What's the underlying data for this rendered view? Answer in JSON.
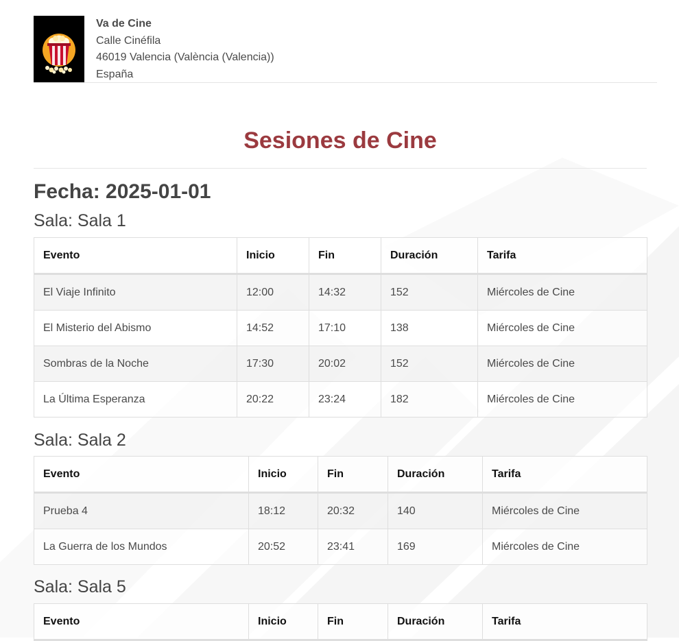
{
  "company": {
    "name": "Va de Cine",
    "street": "Calle Cinéfila",
    "city": "46019 Valencia (València (Valencia))",
    "country": "España"
  },
  "report": {
    "title": "Sesiones de Cine",
    "date_label": "Fecha: 2025-01-01"
  },
  "columns": [
    "Evento",
    "Inicio",
    "Fin",
    "Duración",
    "Tarifa"
  ],
  "rooms": [
    {
      "label": "Sala: Sala 1",
      "rows": [
        [
          "El Viaje Infinito",
          "12:00",
          "14:32",
          "152",
          "Miércoles de Cine"
        ],
        [
          "El Misterio del Abismo",
          "14:52",
          "17:10",
          "138",
          "Miércoles de Cine"
        ],
        [
          "Sombras de la Noche",
          "17:30",
          "20:02",
          "152",
          "Miércoles de Cine"
        ],
        [
          "La Última Esperanza",
          "20:22",
          "23:24",
          "182",
          "Miércoles de Cine"
        ]
      ]
    },
    {
      "label": "Sala: Sala 2",
      "rows": [
        [
          "Prueba 4",
          "18:12",
          "20:32",
          "140",
          "Miércoles de Cine"
        ],
        [
          "La Guerra de los Mundos",
          "20:52",
          "23:41",
          "169",
          "Miércoles de Cine"
        ]
      ]
    },
    {
      "label": "Sala: Sala 5",
      "rows": []
    }
  ],
  "colors": {
    "title": "#9b3a3f",
    "logo_bg": "#000000",
    "popcorn_red": "#c8102e",
    "popcorn_yellow": "#f5a623"
  },
  "logo_icon": "popcorn-icon"
}
